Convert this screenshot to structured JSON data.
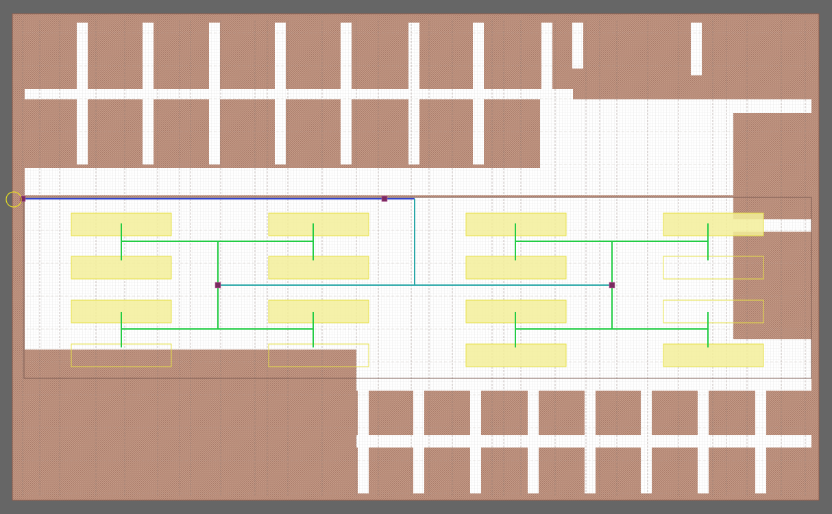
{
  "canvas": {
    "background_color": "#666666",
    "board_color": "#c49a86",
    "hatch_color": "#9a6a5a",
    "free_area_color": "#ffffff",
    "grid_line_color": "#9a9a9a",
    "module_fill_color": "#f3ef9a",
    "module_outline_color": "#e6e045",
    "tree_color": "#22cc44",
    "feed_color": "#3344cc",
    "trunk_color": "#2aa7a7",
    "node_color": "#7a2a60",
    "cursor_color": "#e8e020"
  },
  "legend": {
    "items": []
  },
  "clock_tree": {
    "description_visible": false,
    "module_count": 16,
    "leaf_branch_count": 8,
    "buffer_node_count": 4
  }
}
